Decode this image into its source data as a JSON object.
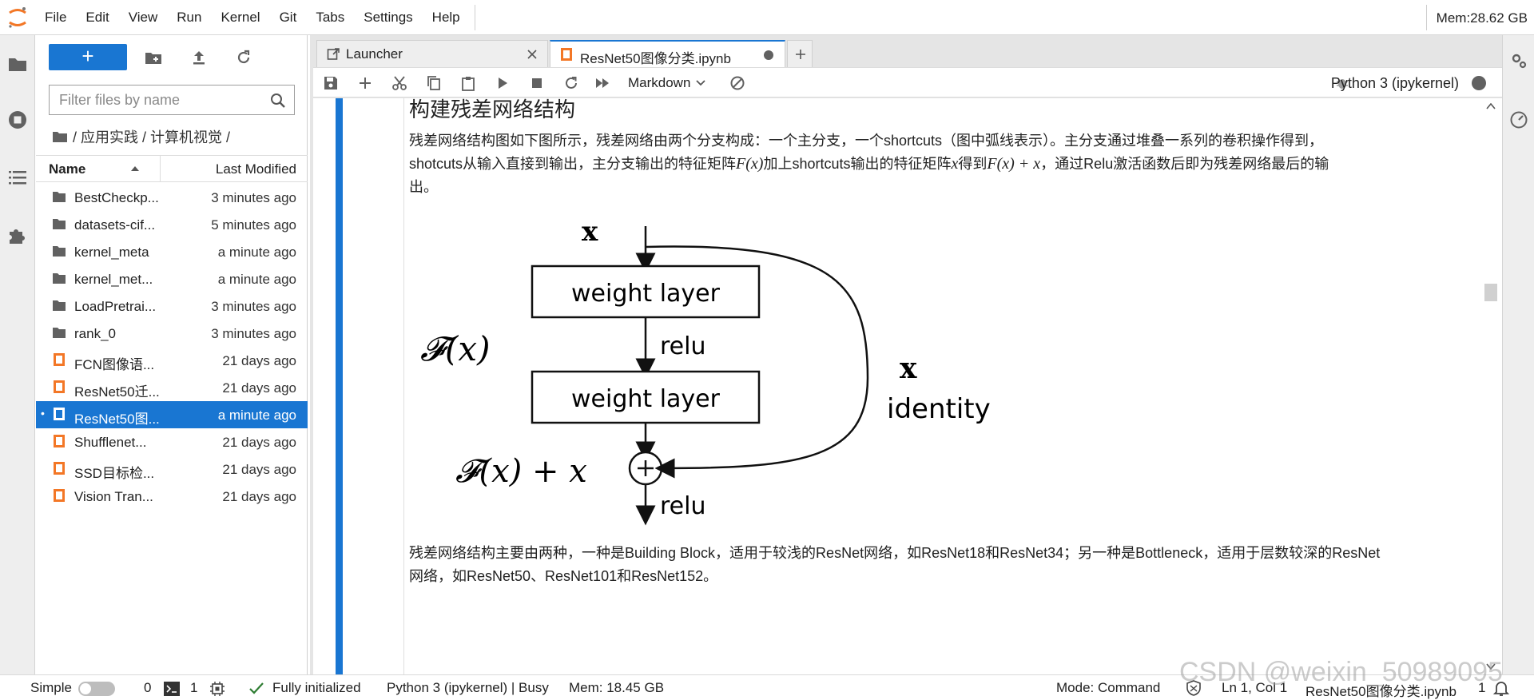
{
  "menubar": {
    "items": [
      "File",
      "Edit",
      "View",
      "Run",
      "Kernel",
      "Git",
      "Tabs",
      "Settings",
      "Help"
    ],
    "memory": "Mem:28.62 GB"
  },
  "filebrowser": {
    "new_label": "+",
    "filter_placeholder": "Filter files by name",
    "breadcrumb": "/ 应用实践 / 计算机视觉 /",
    "col_name": "Name",
    "col_modified": "Last Modified",
    "files": [
      {
        "name": "BestCheckp...",
        "modified": "3 minutes ago",
        "type": "folder"
      },
      {
        "name": "datasets-cif...",
        "modified": "5 minutes ago",
        "type": "folder"
      },
      {
        "name": "kernel_meta",
        "modified": "a minute ago",
        "type": "folder"
      },
      {
        "name": "kernel_met...",
        "modified": "a minute ago",
        "type": "folder"
      },
      {
        "name": "LoadPretrai...",
        "modified": "3 minutes ago",
        "type": "folder"
      },
      {
        "name": "rank_0",
        "modified": "3 minutes ago",
        "type": "folder"
      },
      {
        "name": "FCN图像语...",
        "modified": "21 days ago",
        "type": "notebook"
      },
      {
        "name": "ResNet50迁...",
        "modified": "21 days ago",
        "type": "notebook"
      },
      {
        "name": "ResNet50图...",
        "modified": "a minute ago",
        "type": "notebook",
        "selected": true
      },
      {
        "name": "Shufflenet...",
        "modified": "21 days ago",
        "type": "notebook"
      },
      {
        "name": "SSD目标检...",
        "modified": "21 days ago",
        "type": "notebook"
      },
      {
        "name": "Vision Tran...",
        "modified": "21 days ago",
        "type": "notebook"
      }
    ]
  },
  "tabs": [
    {
      "label": "Launcher"
    },
    {
      "label": "ResNet50图像分类.ipynb"
    }
  ],
  "toolbar": {
    "cell_type": "Markdown",
    "kernel": "Python 3 (ipykernel)"
  },
  "notebook": {
    "heading": "构建残差网络结构",
    "para1_line1": "残差网络结构图如下图所示，残差网络由两个分支构成：一个主分支，一个shortcuts（图中弧线表示）。主分支通过堆叠一系列的卷积操作得到，",
    "para1_line2a": "shotcuts从输入直接到输出，主分支输出的特征矩阵",
    "para1_F": "F(x)",
    "para1_line2b": "加上shortcuts输出的特征矩阵",
    "para1_x": "x",
    "para1_line2c": "得到",
    "para1_Fx": "F(x) + x",
    "para1_line2d": "，通过Relu激活函数后即为残差网络最后的输",
    "para1_line3": "出。",
    "diagram": {
      "input_x": "x",
      "layer1": "weight layer",
      "relu_mid": "relu",
      "layer2": "weight layer",
      "fx_label": "𝓕(x)",
      "identity_x": "x",
      "identity": "identity",
      "sum_label": "𝓕(x) + x",
      "relu_out": "relu"
    },
    "para2_line1": "残差网络结构主要由两种，一种是Building Block，适用于较浅的ResNet网络，如ResNet18和ResNet34；另一种是Bottleneck，适用于层数较深的ResNet",
    "para2_line2": "网络，如ResNet50、ResNet101和ResNet152。"
  },
  "statusbar": {
    "mode_label": "Simple",
    "terminals": "0",
    "kernels": "1",
    "init": "Fully initialized",
    "kernel_status": "Python 3 (ipykernel) | Busy",
    "mem": "Mem: 18.45 GB",
    "mode": "Mode: Command",
    "position": "Ln 1, Col 1",
    "file": "ResNet50图像分类.ipynb",
    "notif_count": "1"
  },
  "watermark": "CSDN @weixin_50989095"
}
